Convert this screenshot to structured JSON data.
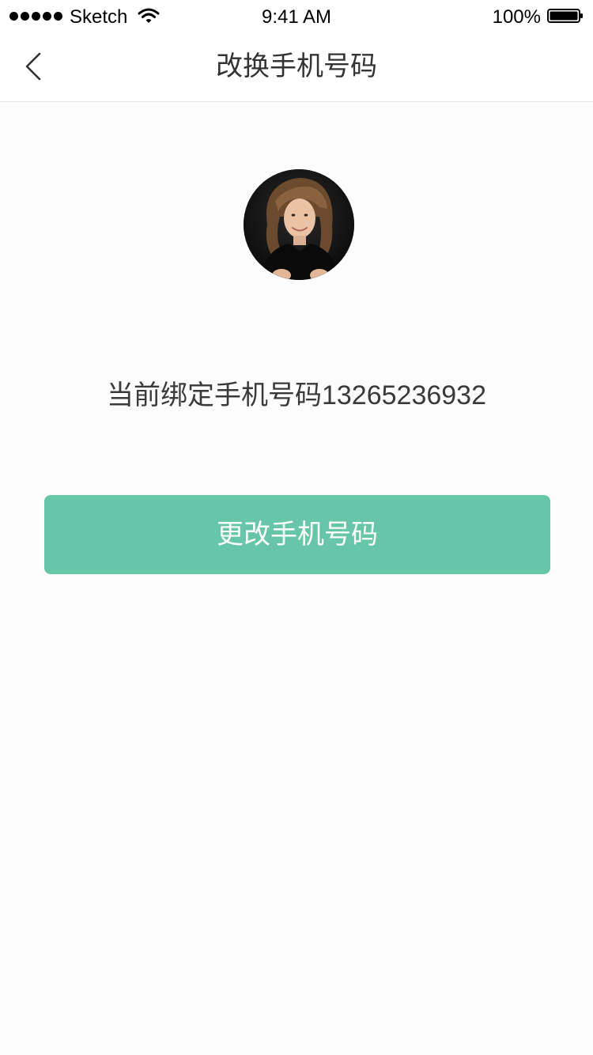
{
  "status_bar": {
    "carrier": "Sketch",
    "time": "9:41 AM",
    "battery": "100%",
    "icons": [
      "signal-dots-icon",
      "wifi-icon",
      "battery-icon"
    ]
  },
  "nav": {
    "title": "改换手机号码",
    "back_icon": "chevron-left-icon"
  },
  "profile": {
    "avatar": "user-avatar",
    "current_phone_text": "当前绑定手机号码13265236932"
  },
  "actions": {
    "change_phone_label": "更改手机号码"
  },
  "colors": {
    "accent": "#67c5a8",
    "background": "#fcfcfc",
    "text": "#333333"
  }
}
